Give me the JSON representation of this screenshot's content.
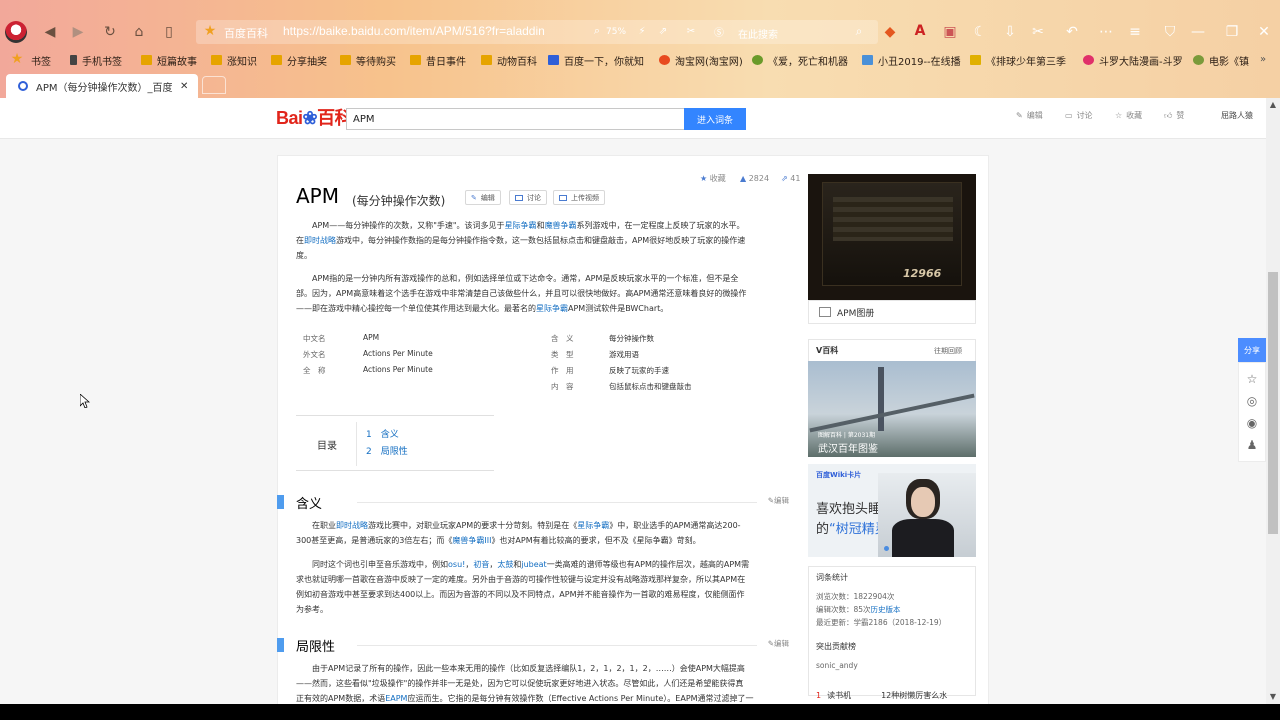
{
  "browser": {
    "url": "https://baike.baidu.com/item/APM/516?fr=aladdin",
    "site_label": "百度百科",
    "zoom": "75%",
    "search_placeholder": "在此搜索",
    "bookmarks": [
      "书签",
      "手机书签",
      "短篇故事",
      "涨知识",
      "分享抽奖",
      "等待购买",
      "昔日事件",
      "动物百科",
      "百度一下，你就知",
      "淘宝网(淘宝网)",
      "《爱，死亡和机器",
      "小丑2019--在线播",
      "《排球少年第三季",
      "斗罗大陆漫画-斗罗",
      "电影《镇"
    ],
    "tab_title": "APM（每分钟操作次数）_百度",
    "tab_close": "✕"
  },
  "header": {
    "logo_text": "Bai",
    "logo_suffix": "百科",
    "search_value": "APM",
    "search_button": "进入词条",
    "actions": [
      "编辑",
      "讨论",
      "收藏",
      "赞"
    ],
    "user": "屈路人猿"
  },
  "article": {
    "title": "APM",
    "subtitle": "(每分钟操作次数)",
    "buttons": [
      "编辑",
      "讨论",
      "上传视频"
    ],
    "favorite": "收藏",
    "likes": "2824",
    "shares": "41",
    "intro_p1_l1a": "APM——每分钟操作的次数，又称\"手速\"。该词多见于",
    "intro_p1_link1": "星际争霸",
    "intro_p1_l1b": "和",
    "intro_p1_link2": "魔兽争霸",
    "intro_p1_l1c": "系列游戏中，在一定程度上反映了玩家的水平。",
    "intro_p1_l2a": "在",
    "intro_p1_link3": "即时战略",
    "intro_p1_l2b": "游戏中，每分钟操作数指的是每分钟操作指令数，这一数包括鼠标点击和键盘敲击，APM很好地反映了玩家的操作速",
    "intro_p1_l3": "度。",
    "intro_p2_l1": "APM指的是一分钟内所有游戏操作的总和，例如选择单位或下达命令。通常，APM是反映玩家水平的一个标准，但不是全",
    "intro_p2_l2": "部。因为，APM高意味着这个选手在游戏中非常清楚自己该做些什么，并且可以很快地做好。高APM通常还意味着良好的微操作",
    "intro_p2_l3a": "——即在游戏中精心操控每一个单位使其作用达到最大化。最著名的",
    "intro_p2_link": "星际争霸",
    "intro_p2_l3b": "APM测试软件是BWChart。",
    "infobox_left": [
      {
        "k": "中文名",
        "v": "APM"
      },
      {
        "k": "外文名",
        "v": "Actions Per Minute"
      },
      {
        "k": "全　称",
        "v": "Actions Per Minute"
      }
    ],
    "infobox_right": [
      {
        "k": "含　义",
        "v": "每分钟操作数"
      },
      {
        "k": "类　型",
        "v": "游戏用语"
      },
      {
        "k": "作　用",
        "v": "反映了玩家的手速"
      },
      {
        "k": "内　容",
        "v": "包括鼠标点击和键盘敲击"
      }
    ],
    "toc_label": "目录",
    "toc_items": [
      "1　含义",
      "2　局限性"
    ],
    "edit_label": "编辑",
    "sec1_title": "含义",
    "sec1_p1_l1a": "在职业",
    "sec1_p1_link1": "即时战略",
    "sec1_p1_l1b": "游戏比赛中，对职业玩家APM的要求十分苛刻。特别是在《",
    "sec1_p1_link2": "星际争霸",
    "sec1_p1_l1c": "》中，职业选手的APM通常高达200-",
    "sec1_p1_l2a": "300甚至更高，是普通玩家的3倍左右；而《",
    "sec1_p1_link3": "魔兽争霸III",
    "sec1_p1_l2b": "》也对APM有着比较高的要求，但不及《星际争霸》苛刻。",
    "sec1_p2_l1a": "同时这个词也引申至音乐游戏中，例如",
    "sec1_p2_link1": "osu!",
    "sec1_p2_l1b": "，",
    "sec1_p2_link2": "初音",
    "sec1_p2_l1c": "，",
    "sec1_p2_link3": "太鼓",
    "sec1_p2_l1d": "和",
    "sec1_p2_link4": "jubeat",
    "sec1_p2_l1e": "一类高难的谱师等级也有APM的操作层次，越高的APM需",
    "sec1_p2_l2": "求也就证明哪一首歌在音游中反映了一定的难度。另外由于音游的可操作性较键与设定并没有战略游戏那样复杂，所以其APM在",
    "sec1_p2_l3": "例如初音游戏中甚至要求到达400以上。而因为音游的不同以及不同特点，APM并不能音操作为一首歌的难易程度，仅能侧面作",
    "sec1_p2_l4": "为参考。",
    "sec2_title": "局限性",
    "sec2_l1": "由于APM记录了所有的操作，因此一些本来无用的操作（比如反复选择编队1，2，1，2，1，2，……）会使APM大幅提高",
    "sec2_l2": "——然而，这些看似\"垃圾操作\"的操作并非一无是处，因为它可以促使玩家更好地进入状态。尽管如此，人们还是希望能获得真",
    "sec2_l3a": "正有效的APM数据，术语",
    "sec2_l3link": "EAPM",
    "sec2_l3b": "应运而生。它指的是每分钟有效操作数（Effective Actions Per Minute）。EAPM通常过滤掉了一"
  },
  "sidebar": {
    "game_score": "12966",
    "gallery_label": "APM图册",
    "v_title": "V百科",
    "v_more": "往期回顾",
    "v_caption_small": "图解百科 | 第2031期",
    "v_caption": "武汉百年图鉴",
    "ad_brand": "百度Wiki卡片",
    "ad_text_l1": "喜欢抱头睡觉",
    "ad_text_l2a": "的",
    "ad_text_l2b": "“树冠精灵”",
    "stats_title": "词条统计",
    "stats_views": "浏览次数：1822904次",
    "stats_edits_a": "编辑次数：85次",
    "stats_edits_link": "历史版本",
    "stats_updated": "最近更新：学霸2186（2018-12-19）",
    "contrib_title": "突出贡献榜",
    "contrib_user": "sonic_andy",
    "list_item_1_num": "1",
    "list_item_1": "读书机",
    "list_item_2": "12种树懒厉害么水"
  },
  "float": {
    "share": "分享"
  },
  "colors": {
    "accent": "#3385ff",
    "link": "#136ec2",
    "logo_red": "#e1251b",
    "section_bar": "#4f9cee"
  }
}
